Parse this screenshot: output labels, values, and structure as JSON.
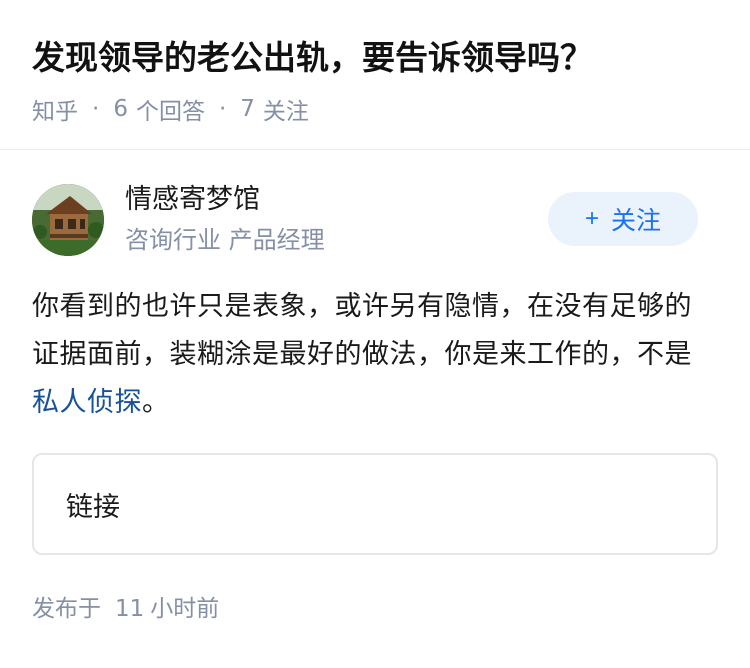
{
  "question": {
    "title": "发现领导的老公出轨，要告诉领导吗？",
    "source": "知乎",
    "answer_count": "6",
    "answer_label": "个回答",
    "follower_count": "7",
    "follower_label": "关注"
  },
  "answer": {
    "author": {
      "name": "情感寄梦馆",
      "description": "咨询行业 产品经理",
      "avatar_icon": "avatar-image"
    },
    "follow_button": {
      "icon": "+",
      "label": "关注"
    },
    "content_before_link": "你看到的也许只是表象，或许另有隐情，在没有足够的证据面前，装糊涂是最好的做法，你是来工作的，不是",
    "content_link": "私人侦探",
    "content_after_link": "。",
    "link_card_label": "链接",
    "publish_prefix": "发布于",
    "publish_num": "11",
    "publish_unit": "小时前"
  },
  "colors": {
    "accent": "#1772f6",
    "link": "#175199",
    "meta": "#8590a6",
    "follow_bg": "#eaf2fb"
  }
}
